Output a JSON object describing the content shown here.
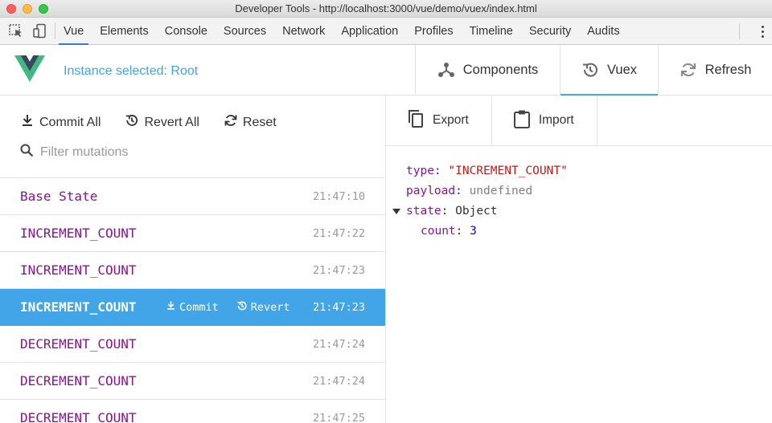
{
  "window": {
    "title": "Developer Tools - http://localhost:3000/vue/demo/vuex/index.html"
  },
  "devtools": {
    "tabs": [
      "Vue",
      "Elements",
      "Console",
      "Sources",
      "Network",
      "Application",
      "Profiles",
      "Timeline",
      "Security",
      "Audits"
    ],
    "active_tab": "Vue"
  },
  "vue_header": {
    "instance_label": "Instance selected: Root",
    "tabs": {
      "components": "Components",
      "vuex": "Vuex",
      "refresh": "Refresh"
    },
    "active_tab": "Vuex",
    "accent_color": "#42a5e8",
    "logo_colors": {
      "outer": "#41b883",
      "inner": "#35495e"
    }
  },
  "history": {
    "actions": {
      "commit_all": "Commit All",
      "revert_all": "Revert All",
      "reset": "Reset"
    },
    "filter_placeholder": "Filter mutations",
    "entries": [
      {
        "name": "Base State",
        "time": "21:47:10"
      },
      {
        "name": "INCREMENT_COUNT",
        "time": "21:47:22"
      },
      {
        "name": "INCREMENT_COUNT",
        "time": "21:47:23"
      },
      {
        "name": "INCREMENT_COUNT",
        "time": "21:47:23"
      },
      {
        "name": "DECREMENT_COUNT",
        "time": "21:47:24"
      },
      {
        "name": "DECREMENT_COUNT",
        "time": "21:47:24"
      },
      {
        "name": "DECREMENT_COUNT",
        "time": "21:47:25"
      }
    ],
    "selected_index": 3,
    "inline_actions": {
      "commit": "Commit",
      "revert": "Revert"
    }
  },
  "inspector": {
    "toolbar": {
      "export": "Export",
      "import": "Import"
    },
    "mutation": {
      "type_key": "type",
      "type_value": "\"INCREMENT_COUNT\"",
      "payload_key": "payload",
      "payload_value": "undefined",
      "state_key": "state",
      "state_value": "Object",
      "count_key": "count",
      "count_value": "3"
    }
  }
}
